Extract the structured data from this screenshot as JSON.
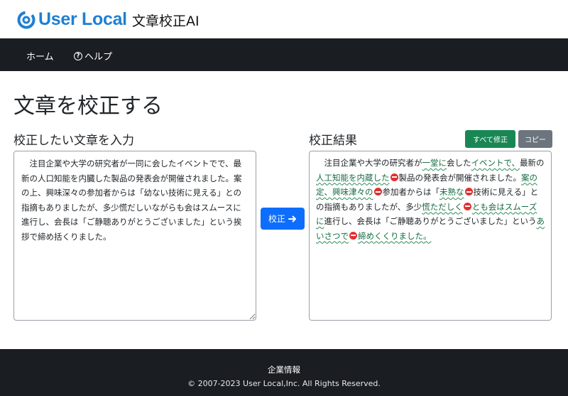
{
  "header": {
    "logo_text": "User Local",
    "app_name": "文章校正AI",
    "brand_color": "#1f7fd3"
  },
  "nav": {
    "home": "ホーム",
    "help": "ヘルプ",
    "help_icon": "question-circle-icon"
  },
  "main": {
    "title": "文章を校正する",
    "input_label": "校正したい文章を入力",
    "output_label": "校正結果",
    "input_text": "　注目企業や大学の研究者が一同に会したイベントでで、最新の人口知能を内臓した製品の発表会が開催されました。案の上、興味深々の参加者からは「幼ない技術に見える」との指摘もありましたが、多少慌だしいながらも会はスムースに進行し、会長は「ご静聴ありがとうございました」という挨拶で締め括くりました。",
    "correct_button": "校正",
    "fix_all_button": "すべて修正",
    "copy_button": "コピー",
    "result": [
      {
        "t": "　注目企業や大学の研究者が"
      },
      {
        "t": "一堂に",
        "flag": true
      },
      {
        "t": "会した"
      },
      {
        "t": "イベントで、",
        "flag": true
      },
      {
        "t": "最新の"
      },
      {
        "t": "人工知能を内蔵した",
        "flag": true
      },
      {
        "del": true
      },
      {
        "t": "製品の発表会が開催されました。"
      },
      {
        "t": "案の定、興味津々の",
        "flag": true
      },
      {
        "del": true
      },
      {
        "t": "参加者からは「"
      },
      {
        "t": "未熟な",
        "flag": true
      },
      {
        "del": true
      },
      {
        "t": "技術に見える」との指摘もありましたが、多少"
      },
      {
        "t": "慌ただしく",
        "flag": true
      },
      {
        "del": true
      },
      {
        "t": "とも会はスムーズに",
        "flag": true
      },
      {
        "t": "進行し、会長は「ご静聴ありがとうございました」という"
      },
      {
        "t": "あいさつで",
        "flag": true
      },
      {
        "del": true
      },
      {
        "t": "締めくくりました。",
        "flag": true
      }
    ]
  },
  "footer": {
    "link": "企業情報",
    "copyright": "© 2007-2023 User Local,Inc. All Rights Reserved."
  },
  "colors": {
    "navbar": "#1a1d21",
    "primary": "#0d6efd",
    "success": "#198754",
    "secondary": "#6c757d",
    "flag_underline": "#2e8b57",
    "delete_mark": "#e0312f"
  }
}
